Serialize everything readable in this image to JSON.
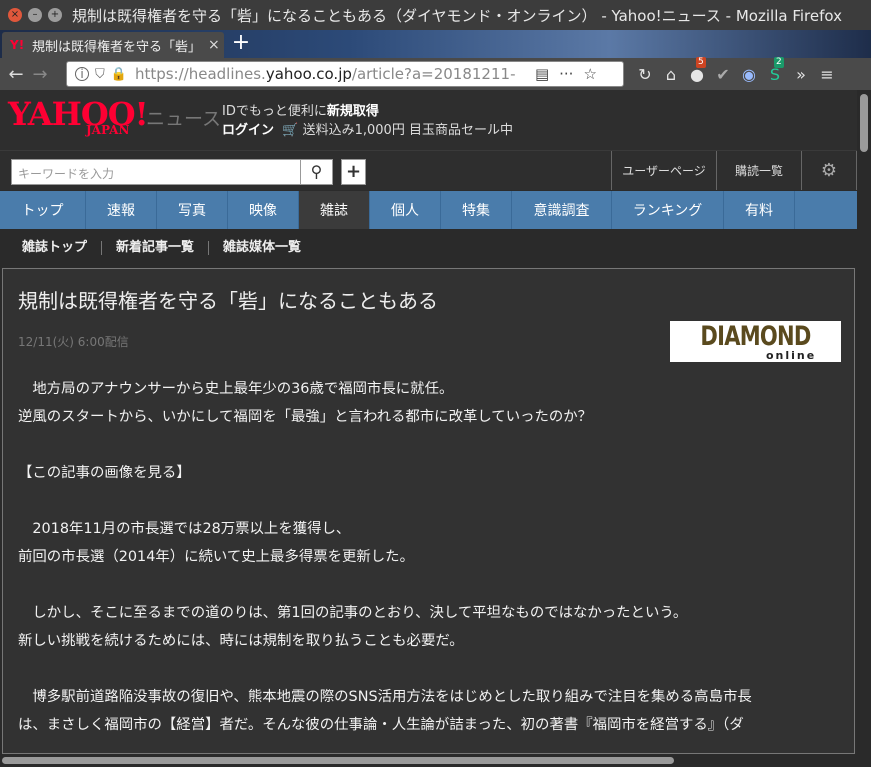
{
  "window": {
    "title": "規制は既得権者を守る「砦」になることもある（ダイヤモンド・オンライン） - Yahoo!ニュース - Mozilla Firefox"
  },
  "tab": {
    "favicon": "Y!",
    "label": "規制は既得権者を守る「砦」になることもある",
    "close": "×",
    "new_tab": "+"
  },
  "navbar": {
    "back": "←",
    "forward": "→",
    "url_prefix": "https://headlines.",
    "url_host": "yahoo.co.jp",
    "url_rest": "/article?a=20181211-",
    "reader": "▤",
    "more": "···",
    "bookmark": "☆",
    "reload": "↻",
    "ext_badges": [
      "5",
      "2"
    ],
    "overflow": "»",
    "menu": "≡"
  },
  "header": {
    "logo": "YAHOO!",
    "logo_sub": "JAPAN",
    "section": "ニュース",
    "line1_text": "IDでもっと便利に",
    "line1_bold": "新規取得",
    "login": "ログイン",
    "promo": "送料込み1,000円 目玉商品セール中"
  },
  "search": {
    "placeholder": "キーワードを入力",
    "icon": "🔍",
    "plus": "+",
    "user_page": "ユーザーページ",
    "subscriptions": "購読一覧",
    "gear": "⚙"
  },
  "categories": [
    {
      "label": "トップ",
      "width": 86
    },
    {
      "label": "速報",
      "width": 71
    },
    {
      "label": "写真",
      "width": 71
    },
    {
      "label": "映像",
      "width": 71
    },
    {
      "label": "雑誌",
      "width": 71
    },
    {
      "label": "個人",
      "width": 71
    },
    {
      "label": "特集",
      "width": 71
    },
    {
      "label": "意識調査",
      "width": 100
    },
    {
      "label": "ランキング",
      "width": 112
    },
    {
      "label": "有料",
      "width": 71
    }
  ],
  "active_category": "雑誌",
  "subnav": [
    "雑誌トップ",
    "新着記事一覧",
    "雑誌媒体一覧"
  ],
  "article": {
    "title": "規制は既得権者を守る「砦」になることもある",
    "date": "12/11(火) 6:00配信",
    "source_logo": "DIAMOND",
    "source_logo_sub": "online",
    "paragraphs": [
      "　地方局のアナウンサーから史上最年少の36歳で福岡市長に就任。",
      "逆風のスタートから、いかにして福岡を「最強」と言われる都市に改革していったのか？",
      "",
      "【この記事の画像を見る】",
      "",
      "　2018年11月の市長選では28万票以上を獲得し、",
      "前回の市長選（2014年）に続いて史上最多得票を更新した。",
      "",
      "　しかし、そこに至るまでの道のりは、第1回の記事のとおり、決して平坦なものではなかったという。",
      "新しい挑戦を続けるためには、時には規制を取り払うことも必要だ。",
      "",
      "　博多駅前道路陥没事故の復旧や、熊本地震の際のSNS活用方法をはじめとした取り組みで注目を集める高島市長",
      "は、まさしく福岡市の【経営】者だ。そんな彼の仕事論・人生論が詰まった、初の著書『福岡市を経営する』（ダ"
    ]
  }
}
